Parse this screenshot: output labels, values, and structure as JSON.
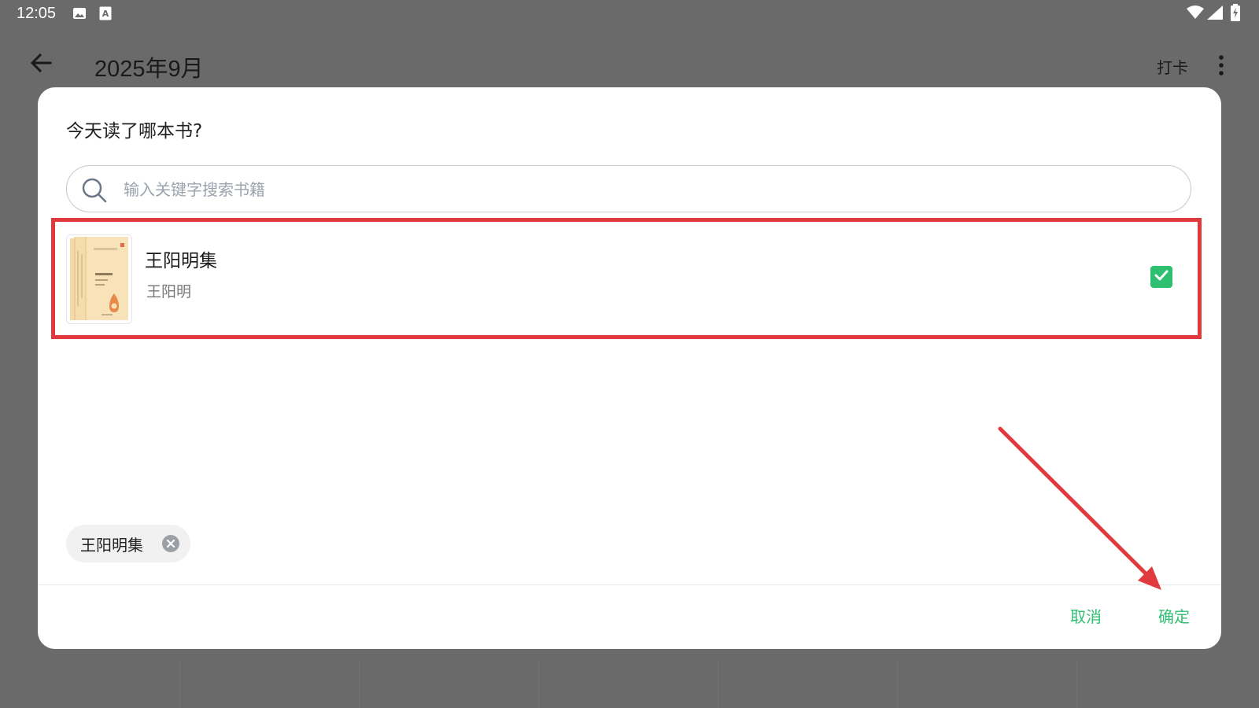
{
  "status_bar": {
    "time": "12:05",
    "left_icons": [
      "image-icon",
      "a-letter-icon"
    ],
    "right_icons": [
      "wifi-icon",
      "signal-icon",
      "battery-charging-icon"
    ]
  },
  "app_bar": {
    "title": "2025年9月",
    "checkin_label": "打卡",
    "icons": [
      "back-arrow-icon",
      "more-vert-icon"
    ]
  },
  "dialog": {
    "title": "今天读了哪本书?",
    "search": {
      "placeholder": "输入关键字搜索书籍",
      "value": ""
    },
    "books": [
      {
        "title": "王阳明集",
        "author": "王阳明",
        "selected": true
      }
    ],
    "selected_chips": [
      {
        "label": "王阳明集"
      }
    ],
    "actions": {
      "cancel_label": "取消",
      "confirm_label": "确定"
    }
  },
  "colors": {
    "accent": "#2fbf71",
    "highlight": "#e03a3e",
    "scrim": "#6a6a6a"
  }
}
